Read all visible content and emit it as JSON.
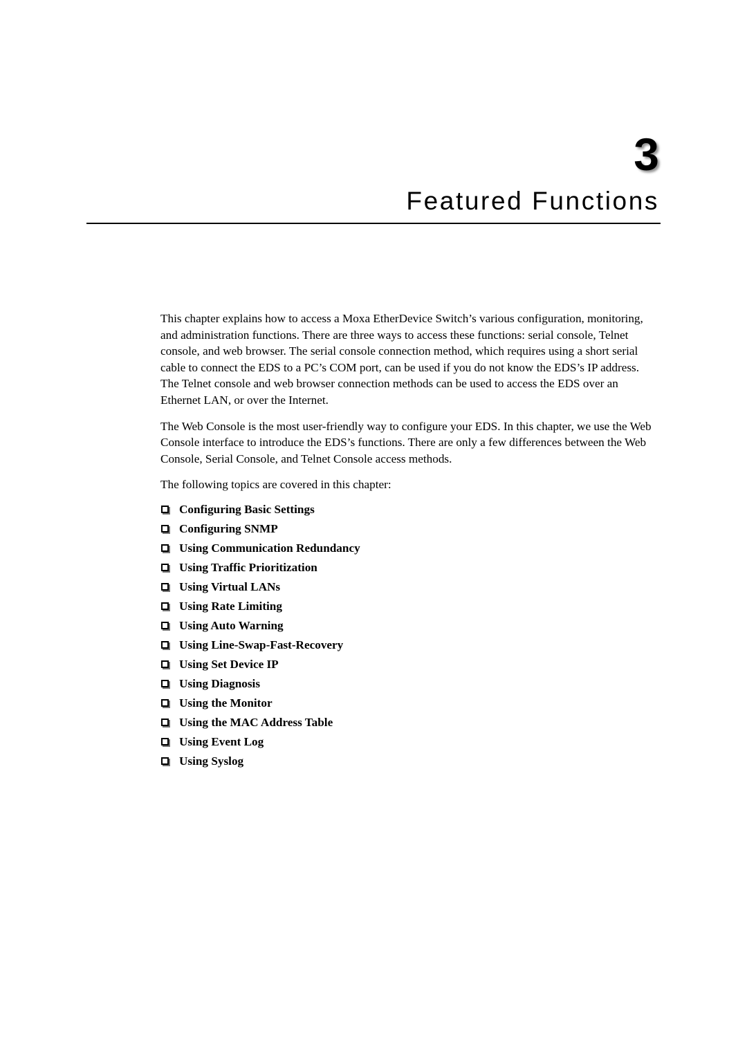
{
  "page": {
    "background_color": "#ffffff",
    "text_color": "#000000"
  },
  "chapter": {
    "number": "3",
    "title": "Featured Functions",
    "rule_color": "#000000"
  },
  "body": {
    "paragraphs": [
      "This chapter explains how to access a Moxa EtherDevice Switch’s various configuration, monitoring, and administration functions. There are three ways to access these functions: serial console, Telnet console, and web browser. The serial console connection method, which requires using a short serial cable to connect the EDS to a PC’s COM port, can be used if you do not know the EDS’s IP address. The Telnet console and web browser connection methods can be used to access the EDS over an Ethernet LAN, or over the Internet.",
      "The Web Console is the most user-friendly way to configure your EDS. In this chapter, we use the Web Console interface to introduce the EDS’s functions. There are only a few differences between the Web Console, Serial Console, and Telnet Console access methods."
    ],
    "intro_line": "The following topics are covered in this chapter:"
  },
  "topics": {
    "bullet_glyph": "hollow-square",
    "items": [
      {
        "label": "Configuring Basic Settings"
      },
      {
        "label": "Configuring SNMP"
      },
      {
        "label": "Using Communication Redundancy"
      },
      {
        "label": "Using Traffic Prioritization"
      },
      {
        "label": "Using Virtual LANs"
      },
      {
        "label": "Using Rate Limiting"
      },
      {
        "label": "Using Auto Warning"
      },
      {
        "label": "Using Line-Swap-Fast-Recovery"
      },
      {
        "label": "Using Set Device IP"
      },
      {
        "label": "Using Diagnosis"
      },
      {
        "label": "Using the Monitor"
      },
      {
        "label": "Using the MAC Address Table"
      },
      {
        "label": "Using Event Log"
      },
      {
        "label": "Using Syslog"
      }
    ]
  }
}
